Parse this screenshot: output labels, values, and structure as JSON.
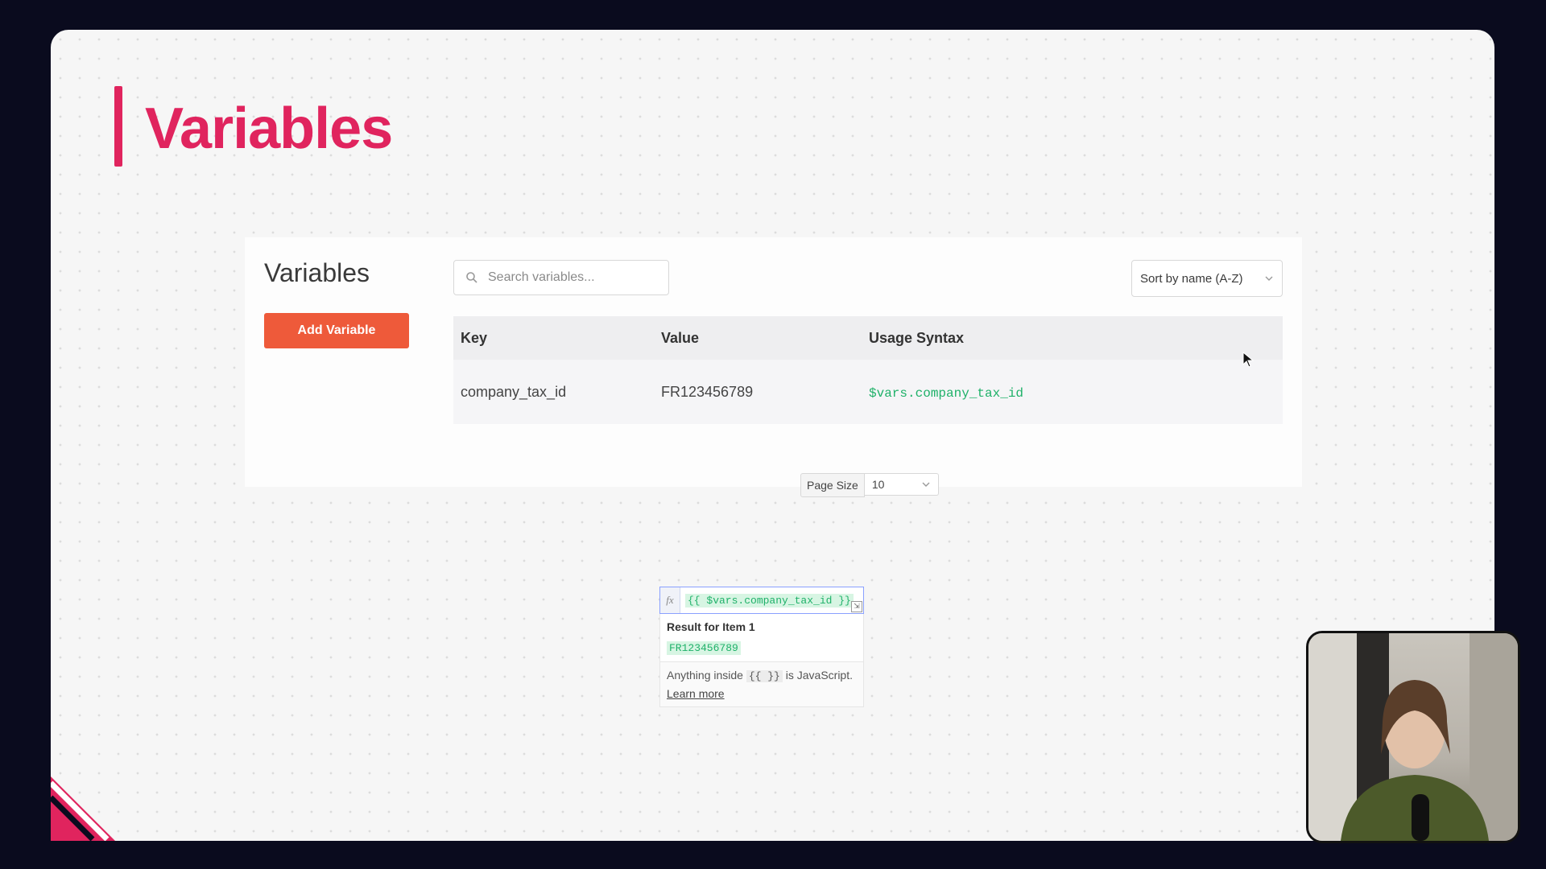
{
  "slide": {
    "title": "Variables",
    "accent_color": "#e0245e"
  },
  "panel": {
    "title": "Variables",
    "add_button_label": "Add Variable",
    "add_button_color": "#ee5a3a",
    "search": {
      "placeholder": "Search variables...",
      "icon": "search-icon"
    },
    "sort": {
      "selected": "Sort by name (A-Z)",
      "icon": "chevron-down-icon"
    },
    "table": {
      "headers": [
        "Key",
        "Value",
        "Usage Syntax"
      ],
      "rows": [
        {
          "key": "company_tax_id",
          "value": "FR123456789",
          "syntax": "$vars.company_tax_id"
        }
      ]
    },
    "pagination": {
      "label": "Page Size",
      "selected": "10"
    }
  },
  "expression": {
    "fx_label": "fx",
    "code": "{{ $vars.company_tax_id }}",
    "result_title": "Result for Item 1",
    "result_value": "FR123456789",
    "note_before": "Anything inside",
    "note_braces": "{{ }}",
    "note_after": "is JavaScript.",
    "learn_more": "Learn more",
    "syntax_color": "#1fb169"
  }
}
